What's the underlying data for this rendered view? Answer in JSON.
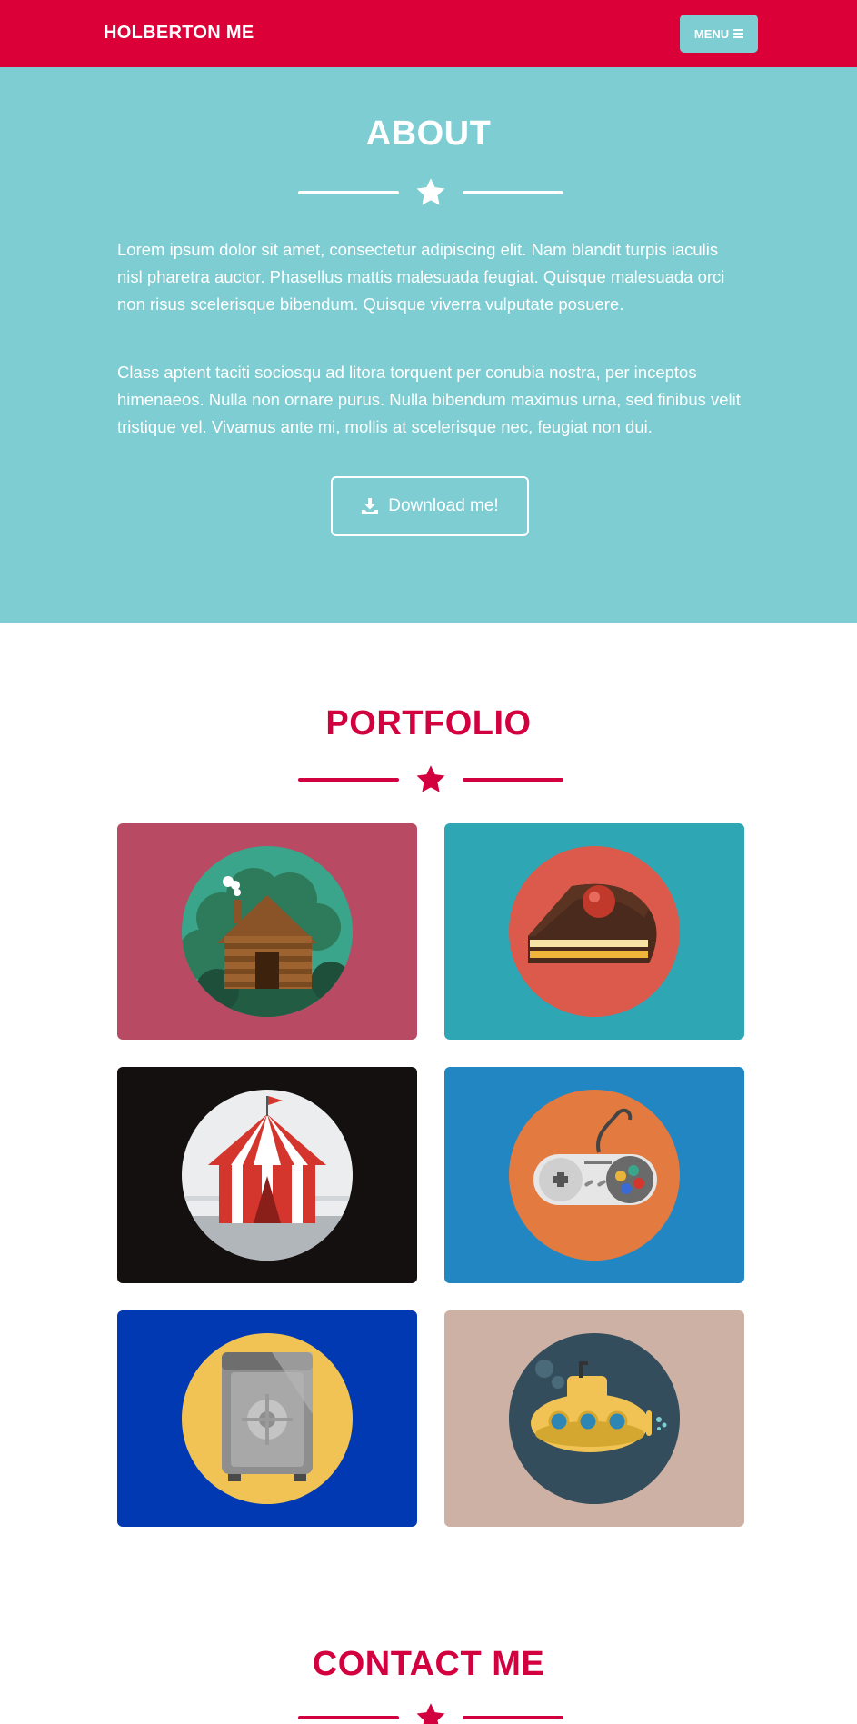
{
  "nav": {
    "brand": "HOLBERTON ME",
    "menu_label": "MENU"
  },
  "about": {
    "title": "ABOUT",
    "paragraphs": [
      "Lorem ipsum dolor sit amet, consectetur adipiscing elit. Nam blandit turpis iaculis nisl pharetra auctor. Phasellus mattis malesuada feugiat. Quisque malesuada orci non risus scelerisque bibendum. Quisque viverra vulputate posuere.",
      "Class aptent taciti sociosqu ad litora torquent per conubia nostra, per inceptos himenaeos. Nulla non ornare purus. Nulla bibendum maximus urna, sed finibus velit tristique vel. Vivamus ante mi, mollis at scelerisque nec, feugiat non dui."
    ],
    "download_label": "Download me!"
  },
  "portfolio": {
    "title": "PORTFOLIO",
    "items": [
      {
        "icon": "cabin-icon",
        "bg": "#b84a63",
        "circle": "#3aa58a"
      },
      {
        "icon": "cake-icon",
        "bg": "#2ea6b4",
        "circle": "#dc5a4b"
      },
      {
        "icon": "circus-tent-icon",
        "bg": "#141010",
        "circle": "#ebedee"
      },
      {
        "icon": "game-controller-icon",
        "bg": "#2286c3",
        "circle": "#e37a40"
      },
      {
        "icon": "safe-icon",
        "bg": "#0039b2",
        "circle": "#f0c354"
      },
      {
        "icon": "submarine-icon",
        "bg": "#cdb1a4",
        "circle": "#334d5c"
      }
    ]
  },
  "contact": {
    "title": "CONTACT ME"
  },
  "colors": {
    "primary": "#dc0039",
    "accent": "#7ecdd2",
    "heading": "#d3003f"
  }
}
